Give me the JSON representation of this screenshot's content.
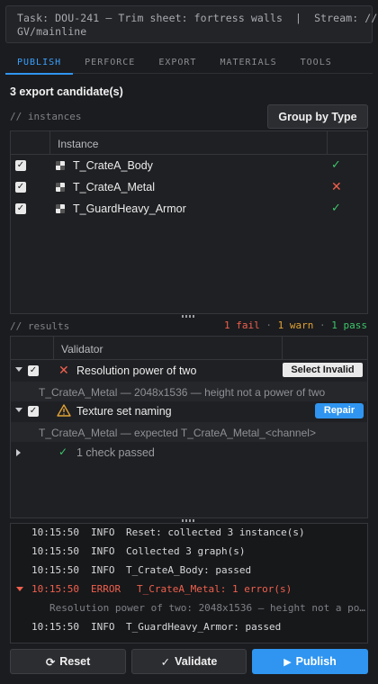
{
  "task_bar": {
    "line1": "Task: DOU-241 — Trim sheet: fortress walls  |  Stream: //",
    "line2": "GV/mainline"
  },
  "tabs": [
    {
      "label": "PUBLISH",
      "active": true
    },
    {
      "label": "PERFORCE",
      "active": false
    },
    {
      "label": "EXPORT",
      "active": false
    },
    {
      "label": "MATERIALS",
      "active": false
    },
    {
      "label": "TOOLS",
      "active": false
    }
  ],
  "candidates": "3 export candidate(s)",
  "instances_label": "// instances",
  "group_button": "Group by Type",
  "instances": {
    "header": "Instance",
    "rows": [
      {
        "name": "T_CrateA_Body",
        "status": "✓",
        "status_type": "pass"
      },
      {
        "name": "T_CrateA_Metal",
        "status": "✕",
        "status_type": "fail"
      },
      {
        "name": "T_GuardHeavy_Armor",
        "status": "✓",
        "status_type": "pass"
      }
    ]
  },
  "results_label": "// results",
  "results_summary": {
    "fail": "1 fail",
    "warn": "1 warn",
    "pass": "1 pass",
    "sep": "·"
  },
  "results": {
    "header": "Validator",
    "items": [
      {
        "title": "Resolution power of two",
        "action": "Select Invalid",
        "detail": "T_CrateA_Metal — 2048x1536 — height not a power of two"
      },
      {
        "title": "Texture set naming",
        "action": "Repair",
        "detail": "T_CrateA_Metal — expected T_CrateA_Metal_<channel>"
      }
    ],
    "passed": "1 check passed"
  },
  "log": [
    {
      "time": "10:15:50",
      "level": "INFO",
      "msg": "Reset: collected 3 instance(s)"
    },
    {
      "time": "10:15:50",
      "level": "INFO",
      "msg": "Collected 3 graph(s)"
    },
    {
      "time": "10:15:50",
      "level": "INFO",
      "msg": "T_CrateA_Body: passed"
    },
    {
      "time": "10:15:50",
      "level": "ERROR",
      "msg": "T_CrateA_Metal: 1 error(s)"
    },
    {
      "sub": "Resolution power of two: 2048x1536 — height not a po…"
    },
    {
      "time": "10:15:50",
      "level": "INFO",
      "msg": "T_GuardHeavy_Armor: passed"
    }
  ],
  "buttons": {
    "reset": "Reset",
    "validate": "Validate",
    "publish": "Publish"
  },
  "colors": {
    "accent": "#2f95f0",
    "pass": "#3cc56b",
    "fail": "#f0604d",
    "warn": "#e0a236"
  }
}
